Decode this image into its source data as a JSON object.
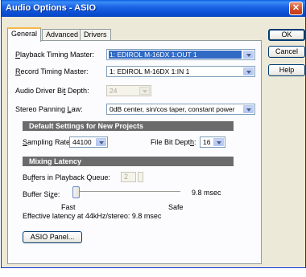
{
  "window": {
    "title": "Audio Options - ASIO",
    "close_icon": "close-icon"
  },
  "tabs": [
    {
      "label": "General",
      "active": true
    },
    {
      "label": "Advanced",
      "active": false
    },
    {
      "label": "Drivers",
      "active": false
    }
  ],
  "general": {
    "playback_master": {
      "label_key": "P",
      "label_rest": "layback Timing Master:",
      "value": "1: EDIROL M-16DX 1:OUT 1"
    },
    "record_master": {
      "label_key": "R",
      "label_rest": "ecord Timing Master:",
      "value": "1: EDIROL M-16DX 1:IN 1"
    },
    "bit_depth": {
      "label_pre": "Audio Driver Bi",
      "label_key": "t",
      "label_rest": " Depth:",
      "value": "24"
    },
    "panning": {
      "label_pre": "Stereo Panning ",
      "label_key": "L",
      "label_rest": "aw:",
      "value": "0dB center, sin/cos taper, constant power"
    }
  },
  "default_settings": {
    "header": "Default Settings for New Projects",
    "sampling_rate": {
      "label_key": "S",
      "label_rest": "ampling Rate:",
      "value": "44100"
    },
    "file_bit_depth": {
      "label_pre": "File Bit Dept",
      "label_key": "h",
      "label_rest": ":",
      "value": "16"
    }
  },
  "mixing_latency": {
    "header": "Mixing Latency",
    "buffers": {
      "label_pre": "Bu",
      "label_key": "f",
      "label_rest": "fers in Playback Queue:",
      "value": "2"
    },
    "buffer_size": {
      "label_pre": "Buffer Si",
      "label_key": "z",
      "label_rest": "e:",
      "value_text": "9.8 msec",
      "position": 0
    },
    "fast_label": "Fast",
    "safe_label": "Safe",
    "effective": "Effective latency at 44kHz/stereo:  9.8 msec"
  },
  "asio_panel_button": "ASIO Panel...",
  "buttons": {
    "ok": "OK",
    "cancel": "Cancel",
    "help": "Help"
  }
}
